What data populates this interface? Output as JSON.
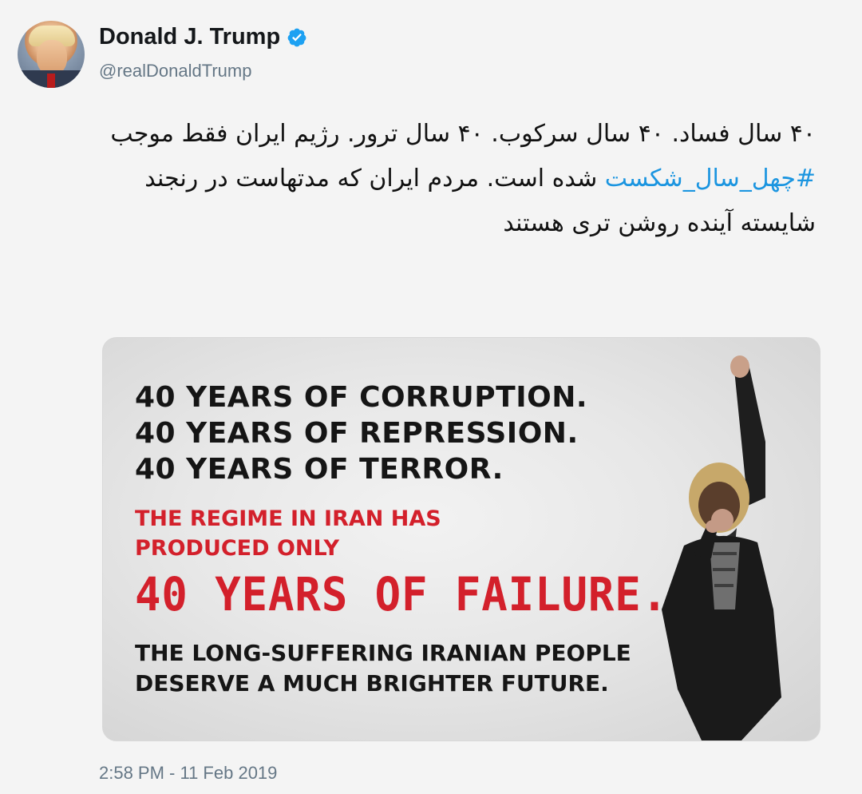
{
  "author": {
    "name": "Donald J. Trump",
    "handle": "@realDonaldTrump",
    "verified": true
  },
  "tweet": {
    "text_before": "۴۰ سال فساد. ۴۰ سال سرکوب. ۴۰ سال ترور. رژیم ایران فقط موجب ",
    "hashtag": "#چهل_سال_شکست",
    "text_after": " شده است. مردم ایران که مدتهاست در رنجند شایسته آینده روشن تری هستند",
    "hashtag_color": "#1b95e0"
  },
  "media": {
    "lines_black": [
      "40 YEARS OF CORRUPTION.",
      "40 YEARS OF REPRESSION.",
      "40 YEARS OF TERROR."
    ],
    "lines_red_small": [
      "THE REGIME IN IRAN HAS",
      "PRODUCED ONLY"
    ],
    "line_red_big": "40 YEARS OF FAILURE.",
    "lines_bottom": [
      "THE LONG-SUFFERING IRANIAN PEOPLE",
      "DESERVE A MUCH BRIGHTER FUTURE."
    ],
    "accent_red": "#d3202b"
  },
  "timestamp": "2:58 PM - 11 Feb 2019",
  "icons": {
    "verified": "verified-badge-icon"
  }
}
